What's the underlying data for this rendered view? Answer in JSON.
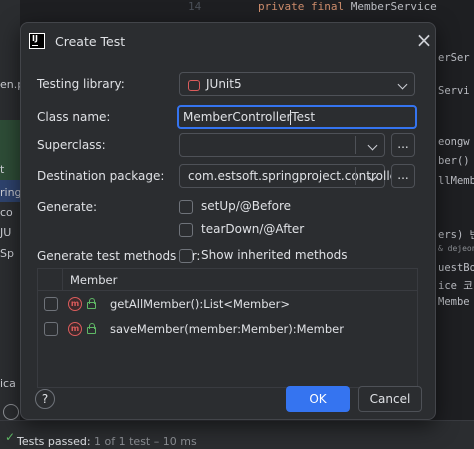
{
  "dialog": {
    "title": "Create Test",
    "app_icon_text": "IJ"
  },
  "form": {
    "testing_library_label": "Testing library:",
    "testing_library_value": "JUnit5",
    "class_name_label": "Class name:",
    "class_name_value": "MemberControllerTest",
    "superclass_label": "Superclass:",
    "superclass_value": "",
    "destination_package_label": "Destination package:",
    "destination_package_value": "com.estsoft.springproject.controller",
    "browse_label": "...",
    "generate_label": "Generate:",
    "setup_label": "setUp/@Before",
    "teardown_label": "tearDown/@After",
    "generate_methods_label": "Generate test methods for:",
    "show_inherited_label": "Show inherited methods"
  },
  "methods_table": {
    "header": "Member",
    "rows": [
      {
        "label": "getAllMember():List<Member>",
        "checked": false
      },
      {
        "label": "saveMember(member:Member):Member",
        "checked": false
      }
    ]
  },
  "footer": {
    "help_label": "?",
    "ok_label": "OK",
    "cancel_label": "Cancel"
  },
  "background": {
    "line_number": "14",
    "code_line_1_kw": "private final",
    "code_line_1_rest": " MemberService",
    "right_fragments": [
      "erSer",
      "Servi",
      "eongw",
      "ber()",
      "llMemb",
      "ers) 반",
      "& dejeong",
      "uestBo",
      "ice 코",
      "Membe"
    ],
    "left_fragments": [
      "en.p",
      "t",
      "ring",
      "co",
      "JU",
      "Sp",
      "ica"
    ],
    "tests_passed": "Tests passed:",
    "tests_detail": "1 of 1 test – 10 ms",
    "success_color": "#5fb865",
    "accent_color": "#3574f0"
  }
}
